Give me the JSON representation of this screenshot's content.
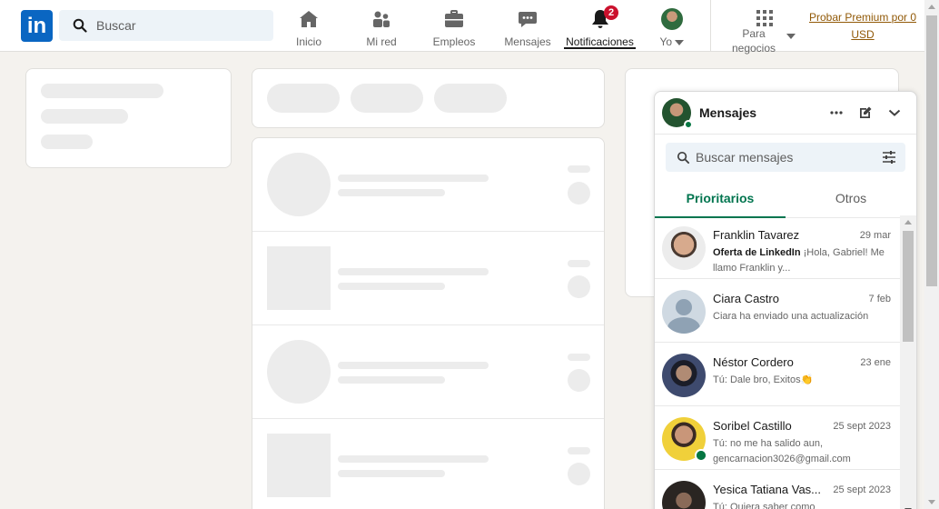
{
  "nav": {
    "logo": "in",
    "search_placeholder": "Buscar",
    "items": [
      {
        "label": "Inicio",
        "icon": "home-icon"
      },
      {
        "label": "Mi red",
        "icon": "people-icon"
      },
      {
        "label": "Empleos",
        "icon": "briefcase-icon"
      },
      {
        "label": "Mensajes",
        "icon": "chat-icon"
      },
      {
        "label": "Notificaciones",
        "icon": "bell-icon",
        "badge": "2"
      },
      {
        "label": "Yo",
        "icon": "avatar"
      },
      {
        "label": "Para negocios",
        "icon": "grid-icon"
      }
    ],
    "premium_label": "Probar Premium por 0 USD"
  },
  "messaging": {
    "title": "Mensajes",
    "search_placeholder": "Buscar mensajes",
    "tabs": [
      "Prioritarios",
      "Otros"
    ],
    "conversations": [
      {
        "name": "Franklin Tavarez",
        "date": "29 mar",
        "sponsored": "Oferta de LinkedIn",
        "snippet": " ¡Hola, Gabriel! Me llamo Franklin y..."
      },
      {
        "name": "Ciara Castro",
        "date": "7 feb",
        "snippet": "Ciara ha enviado una actualización"
      },
      {
        "name": "Néstor Cordero",
        "date": "23 ene",
        "snippet": "Tú: Dale bro, Exitos👏"
      },
      {
        "name": "Soribel Castillo",
        "date": "25 sept 2023",
        "snippet": "Tú: no me ha salido aun, gencarnacion3026@gmail.com"
      },
      {
        "name": "Yesica Tatiana Vas...",
        "date": "25 sept 2023",
        "snippet": "Tú: Quiera saber como"
      }
    ]
  },
  "colors": {
    "brand": "#0a66c2",
    "accent_green": "#01754f",
    "badge_red": "#cb112d",
    "premium": "#915907"
  }
}
